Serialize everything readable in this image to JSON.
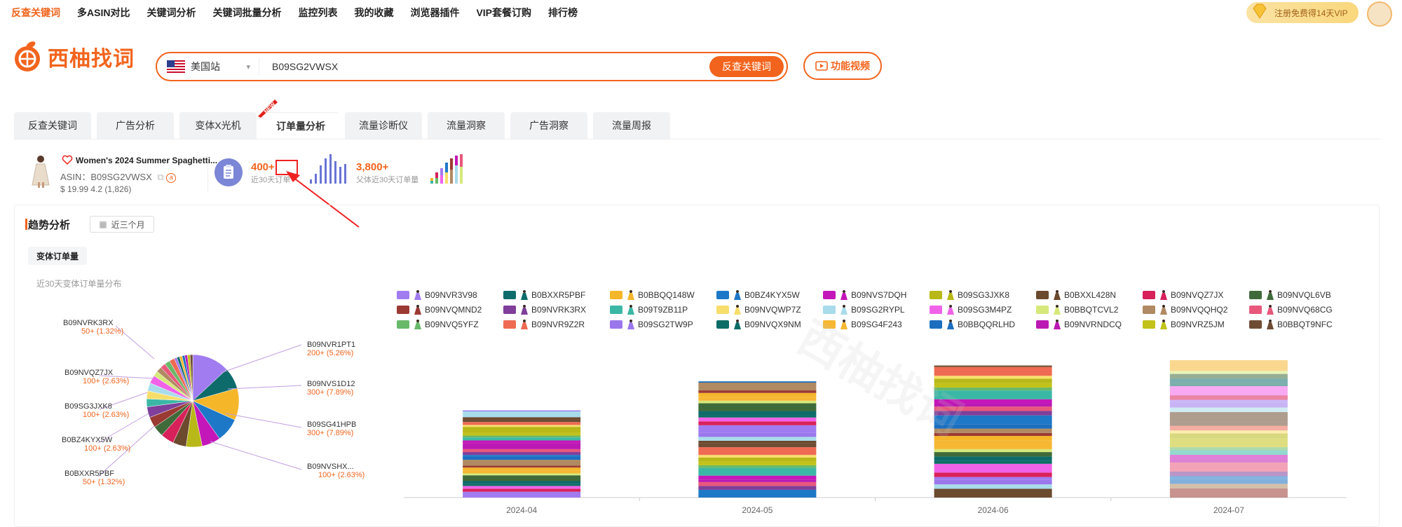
{
  "topnav": {
    "items": [
      "反查关键词",
      "多ASIN对比",
      "关键词分析",
      "关键词批量分析",
      "监控列表",
      "我的收藏",
      "浏览器插件",
      "VIP套餐订购",
      "排行榜"
    ],
    "vip": "注册免费得14天VIP"
  },
  "logo": {
    "text": "西柚找词"
  },
  "search": {
    "site": "美国站",
    "value": "B09SG2VWSX",
    "button": "反查关键词",
    "video": "功能视频"
  },
  "tabs": {
    "items": [
      "反查关键词",
      "广告分析",
      "变体X光机",
      "订单量分析",
      "流量诊断仪",
      "流量洞察",
      "广告洞察",
      "流量周报"
    ],
    "new_badge": "NEW"
  },
  "product": {
    "title": "Women's 2024 Summer Spaghetti...",
    "asin": "ASIN：B09SG2VWSX",
    "price": "$ 19.99 4.2 (1,826)",
    "orders": "400+",
    "orders_sub": "近30天订单",
    "parent_orders": "3,800+",
    "parent_sub": "父体近30天订单量"
  },
  "trend": {
    "title": "趋势分析",
    "range": "近三个月",
    "subtab": "变体订单量",
    "pie_caption": "近30天变体订单量分布"
  },
  "pie_labels": {
    "left": [
      {
        "asin": "B09NVRK3RX",
        "pct": "50+ (1.32%)"
      },
      {
        "asin": "B09NVQZ7JX",
        "pct": "100+ (2.63%)"
      },
      {
        "asin": "B09SG3JXK8",
        "pct": "100+ (2.63%)"
      },
      {
        "asin": "B0BZ4KYX5W",
        "pct": "100+ (2.63%)"
      },
      {
        "asin": "B0BXXR5PBF",
        "pct": "50+ (1.32%)"
      }
    ],
    "right": [
      {
        "asin": "B09NVR1PT1",
        "pct": "200+ (5.26%)"
      },
      {
        "asin": "B09NVS1D12",
        "pct": "300+ (7.89%)"
      },
      {
        "asin": "B09SG41HPB",
        "pct": "300+ (7.89%)"
      },
      {
        "asin": "B09NVSHX...",
        "pct": "100+ (2.63%)"
      }
    ]
  },
  "legend": [
    {
      "name": "B09NVR3V98",
      "color": "#a07cf0"
    },
    {
      "name": "B0BXXR5PBF",
      "color": "#0e6b6b"
    },
    {
      "name": "B0BBQQ148W",
      "color": "#f5b62a"
    },
    {
      "name": "B0BZ4KYX5W",
      "color": "#1e78c8"
    },
    {
      "name": "B09NVS7DQH",
      "color": "#c417b9"
    },
    {
      "name": "B09SG3JXK8",
      "color": "#b8b818"
    },
    {
      "name": "B0BXXL428N",
      "color": "#6b4a2e"
    },
    {
      "name": "B09NVQZ7JX",
      "color": "#d8215a"
    },
    {
      "name": "B09NVQL6VB",
      "color": "#3f6b3a"
    },
    {
      "name": "B09NVQMND2",
      "color": "#9b3a33"
    },
    {
      "name": "B09NVRK3RX",
      "color": "#7f3f9a"
    },
    {
      "name": "B09T9ZB11P",
      "color": "#3bb8a5"
    },
    {
      "name": "B09NVQWP7Z",
      "color": "#f7de6b"
    },
    {
      "name": "B09SG2RYPL",
      "color": "#a8dcea"
    },
    {
      "name": "B09SG3M4PZ",
      "color": "#f062e8"
    },
    {
      "name": "B0BBQTCVL2",
      "color": "#d7e87a"
    },
    {
      "name": "B09NVQQHQ2",
      "color": "#b08a62"
    },
    {
      "name": "B09NVQ68CG",
      "color": "#e9587c"
    },
    {
      "name": "B09NVQ5YFZ",
      "color": "#69b96a"
    },
    {
      "name": "B09NVR9Z2R",
      "color": "#ef6a53"
    },
    {
      "name": "B09SG2TW9P",
      "color": "#9b77ec"
    },
    {
      "name": "B09NVQX9NM",
      "color": "#0d6d66"
    },
    {
      "name": "B09SG4F243",
      "color": "#f6b733"
    },
    {
      "name": "B0BBQQRLHD",
      "color": "#1c6fbf"
    },
    {
      "name": "B09NVRNDCQ",
      "color": "#bb19b3"
    },
    {
      "name": "B09NVRZ5JM",
      "color": "#c2c21a"
    },
    {
      "name": "B0BBQT9NFC",
      "color": "#6e4c33"
    }
  ],
  "chart_data": {
    "type": "bar",
    "stacked": true,
    "categories": [
      "2024-04",
      "2024-05",
      "2024-06",
      "2024-07"
    ],
    "totals_relative": [
      0.66,
      0.88,
      1.0,
      1.04
    ]
  }
}
